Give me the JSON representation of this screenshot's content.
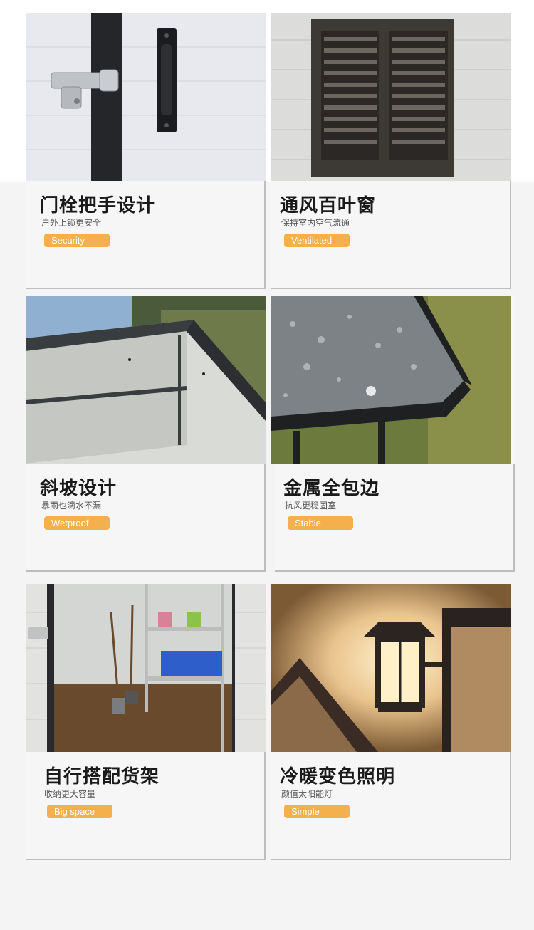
{
  "features": [
    {
      "title": "门栓把手设计",
      "subtitle": "户外上锁更安全",
      "tag": "Security",
      "photo_icon": "door-bolt-handle"
    },
    {
      "title": "通风百叶窗",
      "subtitle": "保持室内空气流通",
      "tag": "Ventilated",
      "photo_icon": "louver-window"
    },
    {
      "title": "斜坡设计",
      "subtitle": "暴雨也滴水不漏",
      "tag": "Wetproof",
      "photo_icon": "sloped-roof"
    },
    {
      "title": "金属全包边",
      "subtitle": "抗风更稳固室",
      "tag": "Stable",
      "photo_icon": "metal-edge"
    },
    {
      "title": "自行搭配货架",
      "subtitle": "收纳更大容量",
      "tag": "Big space",
      "photo_icon": "storage-shelf"
    },
    {
      "title": "冷暖变色照明",
      "subtitle": "颜值太阳能灯",
      "tag": "Simple",
      "photo_icon": "solar-lamp"
    }
  ],
  "colors": {
    "tag_background": "#f5b04e",
    "tag_text": "#ffffff",
    "page_background": "#f4f4f4"
  }
}
